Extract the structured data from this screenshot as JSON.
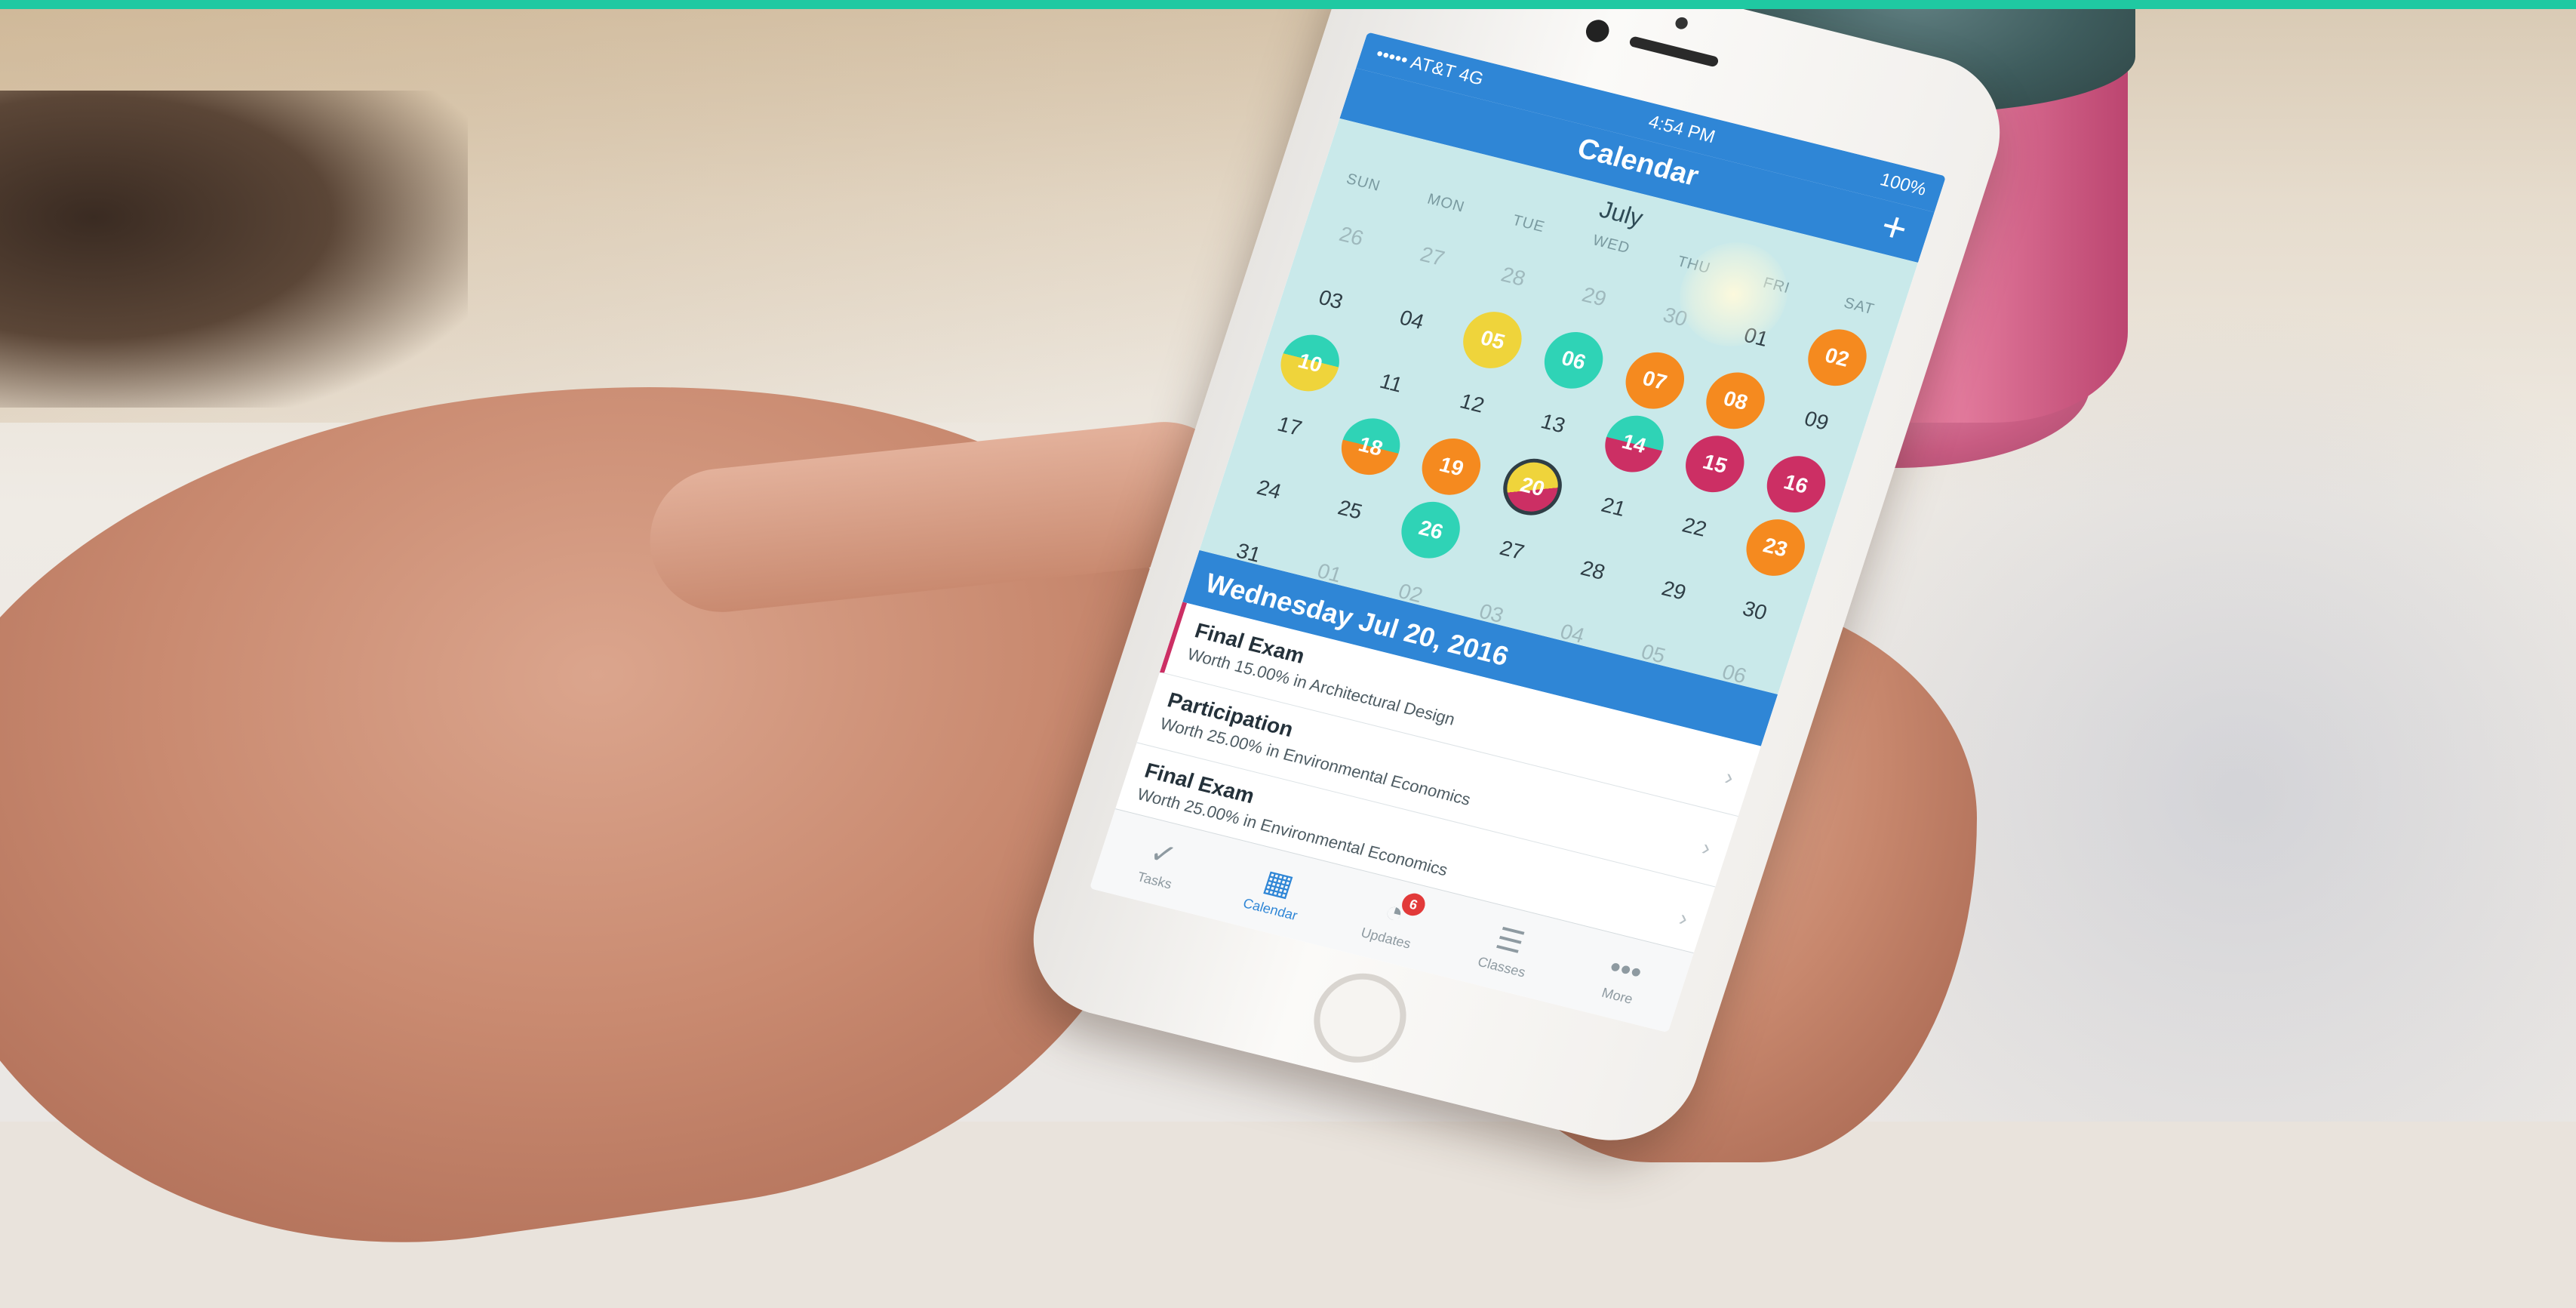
{
  "status_bar": {
    "carrier": "••••• AT&T  4G",
    "time": "4:54 PM",
    "battery": "100%"
  },
  "nav": {
    "title": "Calendar",
    "add_icon": "+"
  },
  "calendar": {
    "month": "July",
    "weekdays": [
      "SUN",
      "MON",
      "TUE",
      "WED",
      "THU",
      "FRI",
      "SAT"
    ],
    "days": [
      {
        "num": "26",
        "style": "muted"
      },
      {
        "num": "27",
        "style": "muted"
      },
      {
        "num": "28",
        "style": "muted"
      },
      {
        "num": "29",
        "style": "muted"
      },
      {
        "num": "30",
        "style": "muted"
      },
      {
        "num": "01",
        "style": ""
      },
      {
        "num": "02",
        "style": "c-orange"
      },
      {
        "num": "03",
        "style": ""
      },
      {
        "num": "04",
        "style": ""
      },
      {
        "num": "05",
        "style": "c-yellow"
      },
      {
        "num": "06",
        "style": "c-teal"
      },
      {
        "num": "07",
        "style": "c-orange"
      },
      {
        "num": "08",
        "style": "c-orange"
      },
      {
        "num": "09",
        "style": ""
      },
      {
        "num": "10",
        "style": "c-teal-yellow"
      },
      {
        "num": "11",
        "style": ""
      },
      {
        "num": "12",
        "style": ""
      },
      {
        "num": "13",
        "style": ""
      },
      {
        "num": "14",
        "style": "c-teal-pink"
      },
      {
        "num": "15",
        "style": "c-pink"
      },
      {
        "num": "16",
        "style": "c-pink"
      },
      {
        "num": "17",
        "style": ""
      },
      {
        "num": "18",
        "style": "c-teal-orange"
      },
      {
        "num": "19",
        "style": "c-orange"
      },
      {
        "num": "20",
        "style": "c-yellow-pink"
      },
      {
        "num": "21",
        "style": ""
      },
      {
        "num": "22",
        "style": ""
      },
      {
        "num": "23",
        "style": "c-orange"
      },
      {
        "num": "24",
        "style": ""
      },
      {
        "num": "25",
        "style": ""
      },
      {
        "num": "26",
        "style": "c-teal"
      },
      {
        "num": "27",
        "style": ""
      },
      {
        "num": "28",
        "style": ""
      },
      {
        "num": "29",
        "style": ""
      },
      {
        "num": "30",
        "style": ""
      },
      {
        "num": "31",
        "style": ""
      },
      {
        "num": "01",
        "style": "muted"
      },
      {
        "num": "02",
        "style": "muted"
      },
      {
        "num": "03",
        "style": "muted"
      },
      {
        "num": "04",
        "style": "muted"
      },
      {
        "num": "05",
        "style": "muted"
      },
      {
        "num": "06",
        "style": "muted"
      }
    ]
  },
  "selected_date": "Wednesday Jul 20, 2016",
  "events": [
    {
      "title": "Final Exam",
      "subtitle": "Worth 15.00% in Architectural Design"
    },
    {
      "title": "Participation",
      "subtitle": "Worth 25.00% in Environmental Economics"
    },
    {
      "title": "Final Exam",
      "subtitle": "Worth 25.00% in Environmental Economics"
    }
  ],
  "tabs": [
    {
      "label": "Tasks",
      "icon": "checkmark-icon",
      "glyph": "✓"
    },
    {
      "label": "Calendar",
      "icon": "calendar-icon",
      "glyph": "▦"
    },
    {
      "label": "Updates",
      "icon": "updates-icon",
      "glyph": "◔",
      "badge": "6"
    },
    {
      "label": "Classes",
      "icon": "stack-icon",
      "glyph": "☰"
    },
    {
      "label": "More",
      "icon": "more-icon",
      "glyph": "•••"
    }
  ],
  "colors": {
    "accent_blue": "#2f86d6",
    "calendar_bg": "#c9e9ea",
    "orange": "#f58a1f",
    "yellow": "#efd43b",
    "teal": "#2fd3b6",
    "pink": "#cc2f64",
    "banner_teal": "#1fc9a2"
  }
}
